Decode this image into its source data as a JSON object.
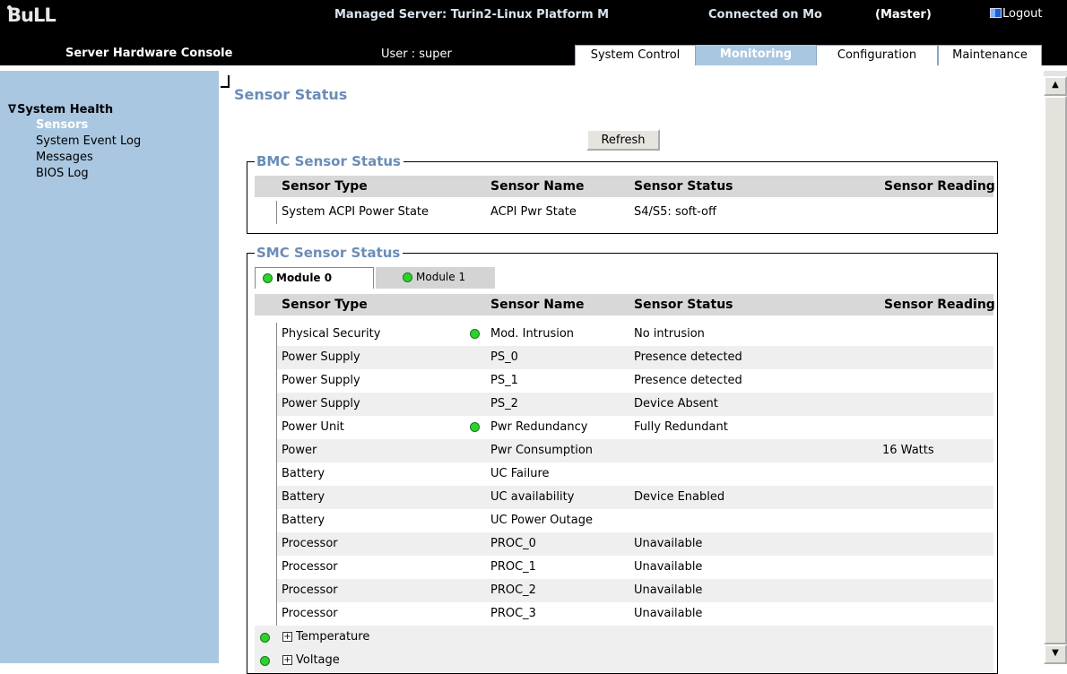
{
  "header": {
    "logo": "BuLL",
    "managed_server": "Managed Server: Turin2-Linux  Platform M",
    "connected": "Connected on Mo",
    "master": "(Master)",
    "logout": "Logout",
    "console_title": "Server Hardware Console",
    "user": "User : super"
  },
  "tabs": [
    {
      "label": "System Control",
      "active": false
    },
    {
      "label": "Monitoring",
      "active": true
    },
    {
      "label": "Configuration",
      "active": false
    },
    {
      "label": "Maintenance",
      "active": false
    }
  ],
  "sidebar": {
    "section": "System Health",
    "items": [
      {
        "label": "Sensors",
        "active": true
      },
      {
        "label": "System Event Log",
        "active": false
      },
      {
        "label": "Messages",
        "active": false
      },
      {
        "label": "BIOS Log",
        "active": false
      }
    ]
  },
  "page": {
    "title": "Sensor Status",
    "refresh_label": "Refresh"
  },
  "bmc": {
    "legend": "BMC Sensor Status",
    "columns": [
      "Sensor Type",
      "Sensor Name",
      "Sensor Status",
      "Sensor Reading"
    ],
    "rows": [
      {
        "type": "System ACPI Power State",
        "name": "ACPI Pwr State",
        "status": "S4/S5: soft-off",
        "reading": ""
      }
    ]
  },
  "smc": {
    "legend": "SMC Sensor Status",
    "module_tabs": [
      {
        "label": "Module 0",
        "selected": true
      },
      {
        "label": "Module 1",
        "selected": false
      }
    ],
    "columns": [
      "Sensor Type",
      "Sensor Name",
      "Sensor Status",
      "Sensor Reading"
    ],
    "rows": [
      {
        "type": "Physical Security",
        "name": "Mod. Intrusion",
        "status": "No intrusion",
        "reading": "",
        "led": true
      },
      {
        "type": "Power Supply",
        "name": "PS_0",
        "status": "Presence detected",
        "reading": "",
        "led": false
      },
      {
        "type": "Power Supply",
        "name": "PS_1",
        "status": "Presence detected",
        "reading": "",
        "led": false
      },
      {
        "type": "Power Supply",
        "name": "PS_2",
        "status": "Device Absent",
        "reading": "",
        "led": false
      },
      {
        "type": "Power Unit",
        "name": "Pwr Redundancy",
        "status": "Fully Redundant",
        "reading": "",
        "led": true
      },
      {
        "type": "Power",
        "name": "Pwr Consumption",
        "status": "",
        "reading": "16 Watts",
        "led": false
      },
      {
        "type": "Battery",
        "name": "UC Failure",
        "status": "",
        "reading": "",
        "led": false
      },
      {
        "type": "Battery",
        "name": "UC availability",
        "status": "Device Enabled",
        "reading": "",
        "led": false
      },
      {
        "type": "Battery",
        "name": "UC Power Outage",
        "status": "",
        "reading": "",
        "led": false
      },
      {
        "type": "Processor",
        "name": "PROC_0",
        "status": "Unavailable",
        "reading": "",
        "led": false
      },
      {
        "type": "Processor",
        "name": "PROC_1",
        "status": "Unavailable",
        "reading": "",
        "led": false
      },
      {
        "type": "Processor",
        "name": "PROC_2",
        "status": "Unavailable",
        "reading": "",
        "led": false
      },
      {
        "type": "Processor",
        "name": "PROC_3",
        "status": "Unavailable",
        "reading": "",
        "led": false
      }
    ],
    "groups": [
      {
        "label": "Temperature"
      },
      {
        "label": "Voltage"
      }
    ]
  },
  "colors": {
    "accent": "#a9c7e0",
    "title": "#6a8db8",
    "led_ok": "#2ed12e"
  }
}
